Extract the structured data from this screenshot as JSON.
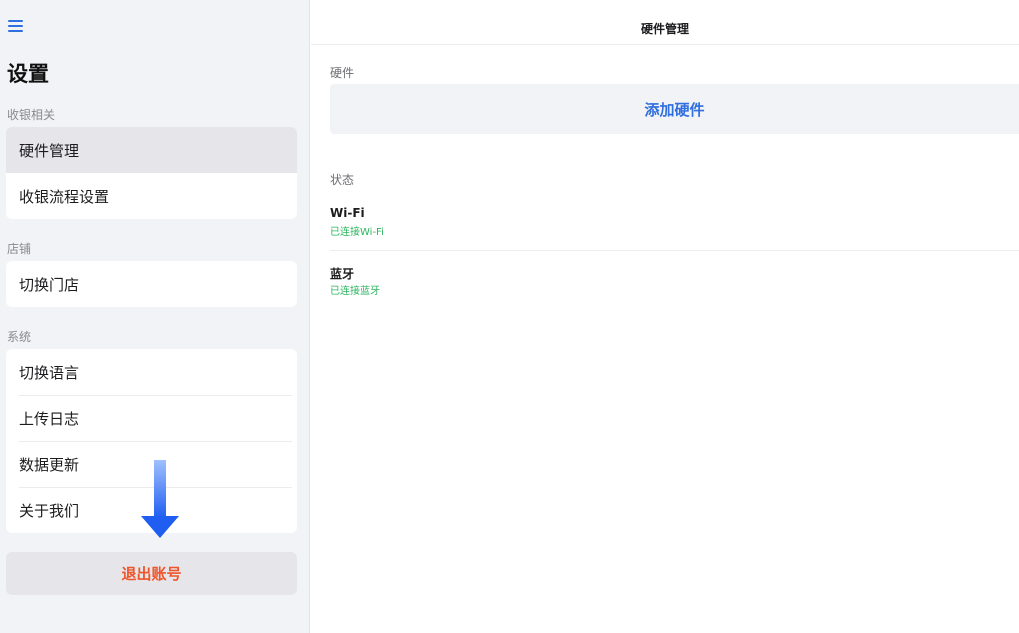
{
  "sidebar": {
    "menu_icon": "hamburger-menu-icon",
    "title": "设置",
    "sections": [
      {
        "label": "收银相关",
        "items": [
          "硬件管理",
          "收银流程设置"
        ]
      },
      {
        "label": "店铺",
        "items": [
          "切换门店"
        ]
      },
      {
        "label": "系统",
        "items": [
          "切换语言",
          "上传日志",
          "数据更新",
          "关于我们"
        ]
      }
    ],
    "selected_item": "硬件管理",
    "logout_label": "退出账号"
  },
  "main": {
    "title": "硬件管理",
    "hardware_label": "硬件",
    "add_hardware_label": "添加硬件",
    "status_label": "状态",
    "status_items": [
      {
        "name": "Wi-Fi",
        "value": "已连接Wi-Fi"
      },
      {
        "name": "蓝牙",
        "value": "已连接蓝牙"
      }
    ]
  },
  "colors": {
    "accent": "#2f6fde",
    "danger": "#f0552a",
    "success": "#2bb55e",
    "sidebar_bg": "#f2f3f7"
  }
}
